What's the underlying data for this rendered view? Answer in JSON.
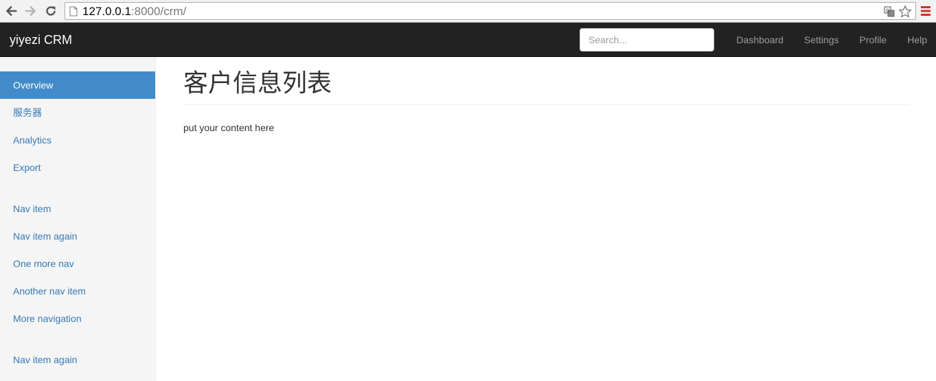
{
  "browser": {
    "url_host": "127.0.0.1",
    "url_rest": ":8000/crm/"
  },
  "navbar": {
    "brand": "yiyezi CRM",
    "search_placeholder": "Search...",
    "links": [
      "Dashboard",
      "Settings",
      "Profile",
      "Help"
    ]
  },
  "sidebar": {
    "group1": [
      "Overview",
      "服务器",
      "Analytics",
      "Export"
    ],
    "group2": [
      "Nav item",
      "Nav item again",
      "One more nav",
      "Another nav item",
      "More navigation"
    ],
    "group3": [
      "Nav item again"
    ]
  },
  "main": {
    "title": "客户信息列表",
    "body": "put your content here"
  },
  "colors": {
    "navbar_bg": "#222222",
    "active_bg": "#428bca",
    "link": "#337ab7",
    "sidebar_bg": "#f5f5f5"
  }
}
